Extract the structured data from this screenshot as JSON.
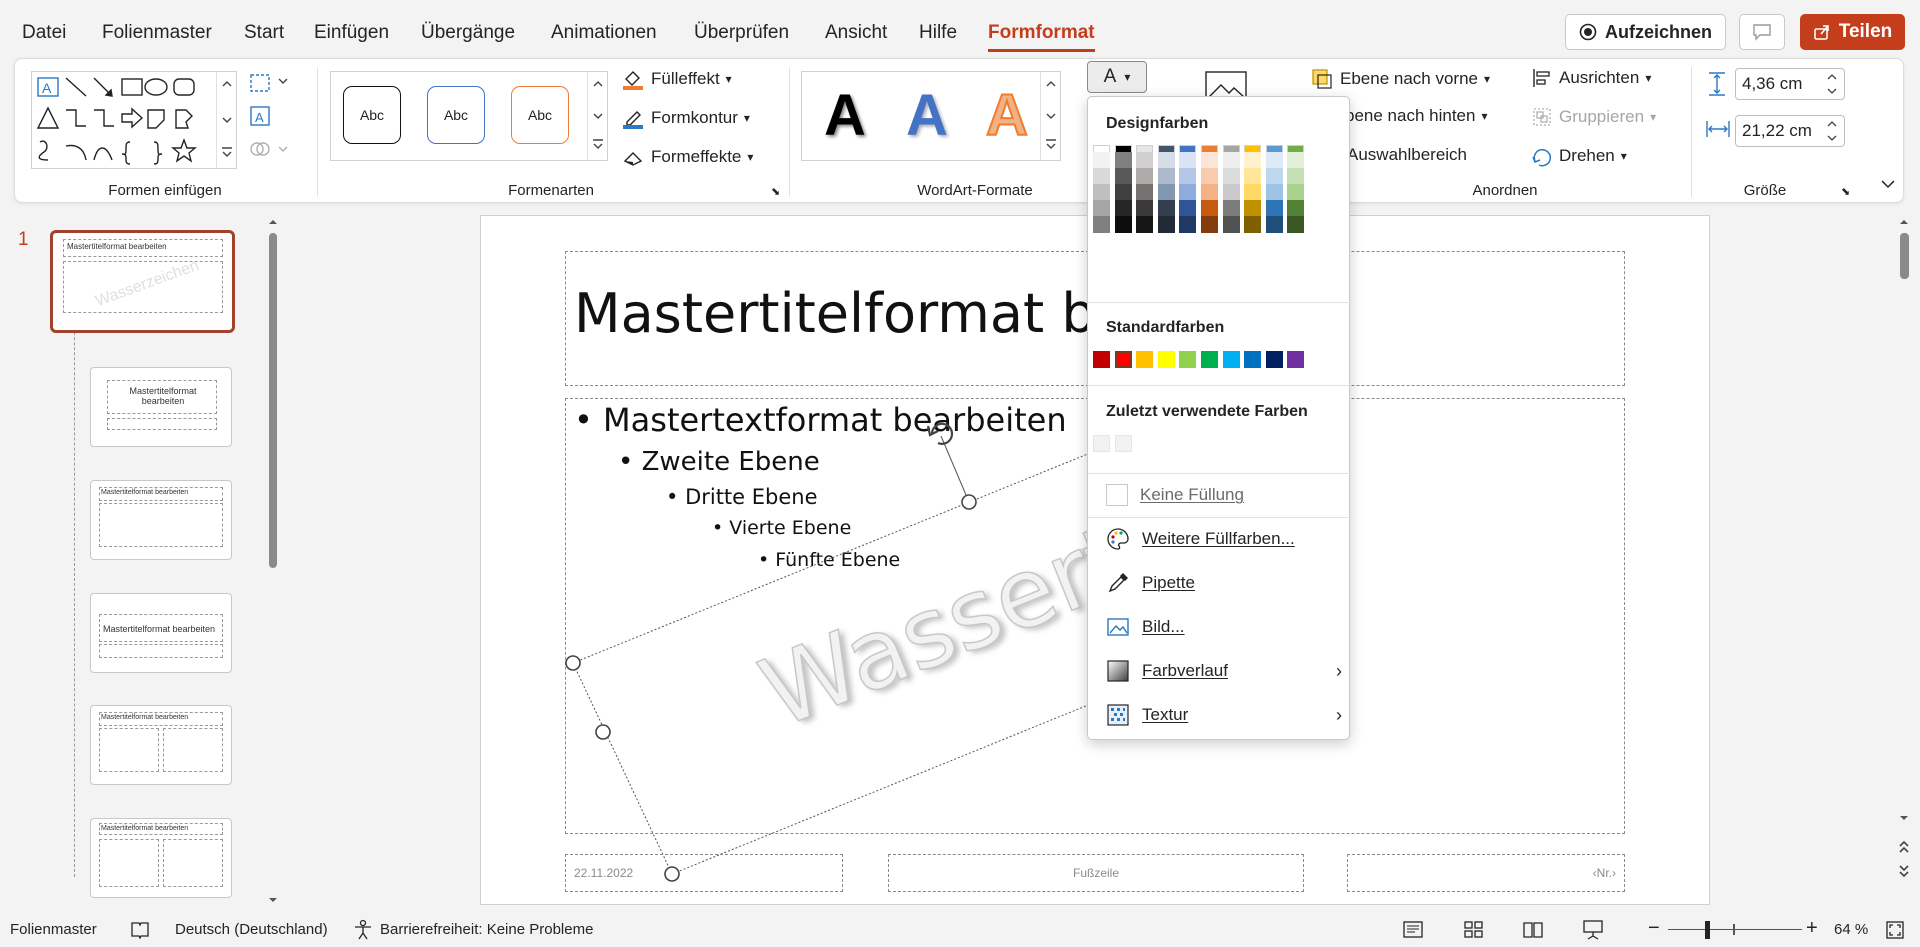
{
  "menu": {
    "tabs": [
      "Datei",
      "Folienmaster",
      "Start",
      "Einfügen",
      "Übergänge",
      "Animationen",
      "Überprüfen",
      "Ansicht",
      "Hilfe",
      "Formformat"
    ],
    "active_tab": "Formformat",
    "record_label": "Aufzeichnen",
    "share_label": "Teilen"
  },
  "ribbon": {
    "groups": {
      "insert_shapes": "Formen einfügen",
      "shape_styles": "Formenarten",
      "wordart_styles": "WordArt-Formate",
      "arrange": "Anordnen",
      "size": "Größe"
    },
    "style_sample": "Abc",
    "fill_effect": "Fülleffekt",
    "shape_outline": "Formkontur",
    "shape_effects": "Formeffekte",
    "wordart_letter": "A",
    "text_fill_letter": "A",
    "bring_forward": "Ebene nach vorne",
    "send_backward": "bene nach hinten",
    "selection_pane": "Auswahlbereich",
    "align": "Ausrichten",
    "group": "Gruppieren",
    "rotate": "Drehen",
    "height": "4,36 cm",
    "width": "21,22 cm"
  },
  "thumbnails": {
    "selected_number": "1",
    "items": [
      {
        "title": "Mastertitelformat bearbeiten"
      },
      {
        "title": "Mastertitelformat bearbeiten"
      },
      {
        "title": "Mastertitelformat bearbeiten"
      },
      {
        "title": "Mastertitelformat bearbeiten"
      },
      {
        "title": "Mastertitelformat bearbeiten"
      },
      {
        "title": "Mastertitelformat bearbeiten"
      }
    ]
  },
  "slide": {
    "title": "Mastertitelformat bear",
    "level1": "Mastertextformat bearbeiten",
    "level2": "Zweite Ebene",
    "level3": "Dritte Ebene",
    "level4": "Vierte Ebene",
    "level5": "Fünfte Ebene",
    "watermark": "Wassert",
    "watermark_tail": "n",
    "date": "22.11.2022",
    "footer": "Fußzeile",
    "number": "‹Nr.›"
  },
  "colordrop": {
    "design_colors_title": "Designfarben",
    "theme_colors": [
      "#ffffff",
      "#000000",
      "#e7e6e6",
      "#44546a",
      "#4472c4",
      "#ed7d31",
      "#a5a5a5",
      "#ffc000",
      "#5b9bd5",
      "#70ad47"
    ],
    "shade_columns": [
      [
        "#f2f2f2",
        "#d9d9d9",
        "#bfbfbf",
        "#a6a6a6",
        "#808080"
      ],
      [
        "#808080",
        "#595959",
        "#404040",
        "#262626",
        "#0d0d0d"
      ],
      [
        "#d0cece",
        "#aeabab",
        "#757171",
        "#3a3838",
        "#171616"
      ],
      [
        "#d6dce5",
        "#adb9ca",
        "#8497b0",
        "#333f50",
        "#222a35"
      ],
      [
        "#dae3f3",
        "#b4c7e7",
        "#8faadc",
        "#2f5597",
        "#203864"
      ],
      [
        "#fbe5d6",
        "#f8cbad",
        "#f4b183",
        "#c55a11",
        "#843c0c"
      ],
      [
        "#ededed",
        "#dbdbdb",
        "#c9c9c9",
        "#7b7b7b",
        "#525252"
      ],
      [
        "#fff2cc",
        "#ffe699",
        "#ffd966",
        "#bf9000",
        "#7f6000"
      ],
      [
        "#deebf7",
        "#bdd7ee",
        "#9dc3e6",
        "#2e75b6",
        "#1f4e79"
      ],
      [
        "#e2f0d9",
        "#c5e0b4",
        "#a9d18e",
        "#548235",
        "#385723"
      ]
    ],
    "standard_title": "Standardfarben",
    "standard_colors": [
      "#c00000",
      "#ff0000",
      "#ffc000",
      "#ffff00",
      "#92d050",
      "#00b050",
      "#00b0f0",
      "#0070c0",
      "#002060",
      "#7030a0"
    ],
    "recent_title": "Zuletzt verwendete Farben",
    "recent_colors": [
      "#f2f2f2",
      "#f2f2f2"
    ],
    "no_fill": "Keine Füllung",
    "more_colors": "Weitere Füllfarben...",
    "eyedropper": "Pipette",
    "picture": "Bild...",
    "gradient": "Farbverlauf",
    "texture": "Textur"
  },
  "status": {
    "view": "Folienmaster",
    "language": "Deutsch (Deutschland)",
    "accessibility": "Barrierefreiheit: Keine Probleme",
    "zoom": "64 %",
    "zoom_level": 0.64
  }
}
